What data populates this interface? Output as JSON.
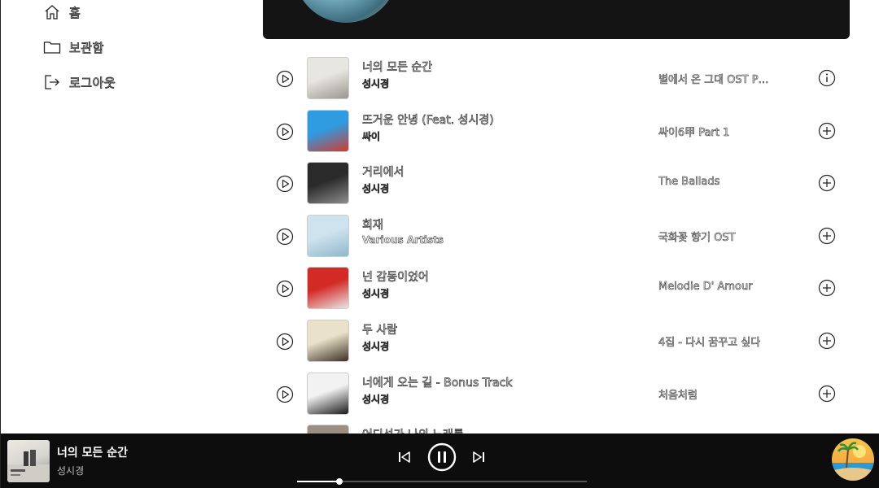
{
  "sidebar": {
    "items": [
      {
        "label": "홈",
        "icon": "home-icon"
      },
      {
        "label": "보관함",
        "icon": "folder-icon"
      },
      {
        "label": "로그아웃",
        "icon": "logout-icon"
      }
    ]
  },
  "tracks": [
    {
      "title": "너의 모든 순간",
      "artist": "성시경",
      "album": "별에서 온 그대 OST P…",
      "thumb": [
        "#e8e6e0",
        "#9a978f"
      ]
    },
    {
      "title": "뜨거운 안녕 (Feat. 성시경)",
      "artist": "싸이",
      "album": "싸이6甲 Part 1",
      "thumb": [
        "#2f9be0",
        "#d23b2e"
      ]
    },
    {
      "title": "거리에서",
      "artist": "성시경",
      "album": "The Ballads",
      "thumb": [
        "#2a2a2a",
        "#8d8d8d"
      ]
    },
    {
      "title": "희재",
      "artist": "Various Artists",
      "album": "국화꽃 향기 OST",
      "thumb": [
        "#cfe3ee",
        "#8fb8cc"
      ]
    },
    {
      "title": "넌 감동이었어",
      "artist": "성시경",
      "album": "Melodie D' Amour",
      "thumb": [
        "#d42a26",
        "#e8e6e6"
      ]
    },
    {
      "title": "두 사람",
      "artist": "성시경",
      "album": "4집 - 다시 꿈꾸고 싶다",
      "thumb": [
        "#e9e1c9",
        "#3b2f24"
      ]
    },
    {
      "title": "너에게 오는 길 - Bonus Track",
      "artist": "성시경",
      "album": "처음처럼",
      "thumb": [
        "#f2f2f2",
        "#1a1a1a"
      ]
    },
    {
      "title": "어디선가 나의 노래를",
      "artist": "",
      "album": "",
      "thumb": [
        "#9a8f80",
        "#5b5147"
      ]
    }
  ],
  "player": {
    "title": "너의 모든 순간",
    "artist": "성시경",
    "progress": 0.146
  }
}
